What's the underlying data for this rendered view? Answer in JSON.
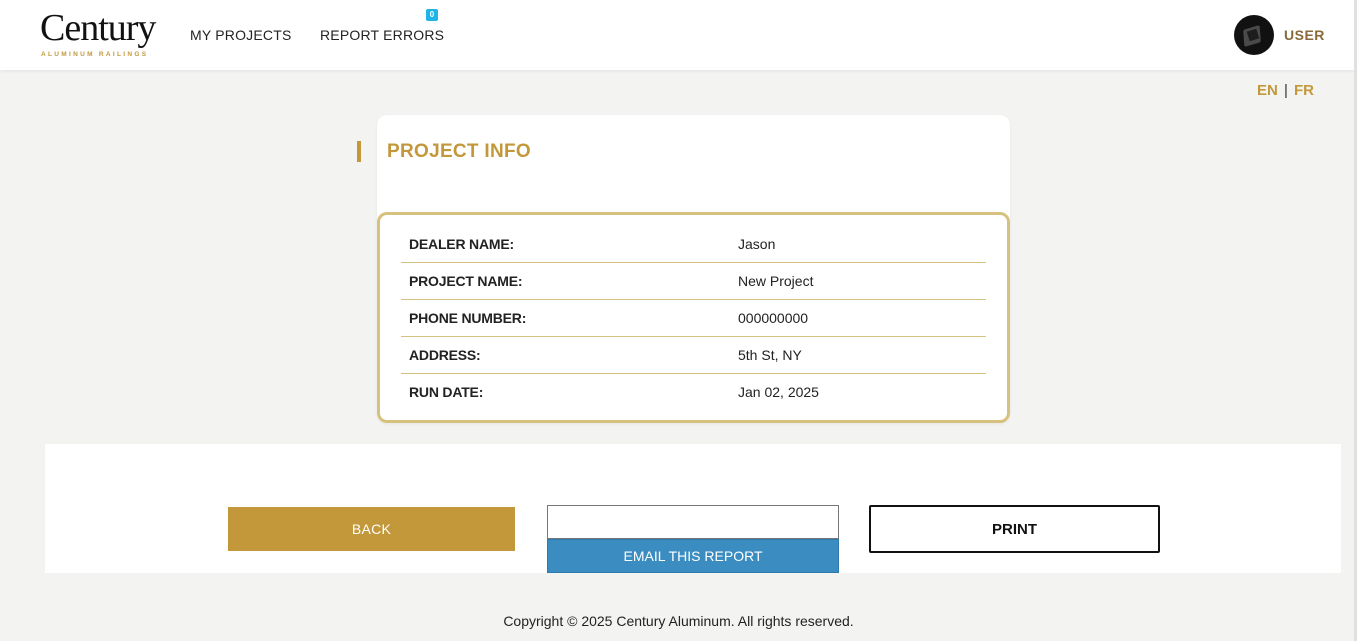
{
  "brand": {
    "logo_main": "Century",
    "logo_sub": "ALUMINUM RAILINGS",
    "accent_color": "#c2983a"
  },
  "nav": {
    "my_projects": "MY PROJECTS",
    "report_errors": "REPORT ERRORS",
    "report_errors_badge": "0",
    "user_label": "USER"
  },
  "language": {
    "en": "EN",
    "separator": "|",
    "fr": "FR"
  },
  "project_info": {
    "title": "PROJECT INFO",
    "rows": [
      {
        "label": "DEALER NAME:",
        "value": "Jason"
      },
      {
        "label": "PROJECT NAME:",
        "value": "New Project"
      },
      {
        "label": "PHONE NUMBER:",
        "value": "000000000"
      },
      {
        "label": "ADDRESS:",
        "value": "5th St, NY"
      },
      {
        "label": "RUN DATE:",
        "value": "Jan 02, 2025"
      }
    ]
  },
  "actions": {
    "back_label": "BACK",
    "email_input_value": "",
    "email_button_label": "EMAIL THIS REPORT",
    "print_label": "PRINT",
    "email_button_color": "#3b8cc0"
  },
  "footer": {
    "copyright": "Copyright © 2025 Century Aluminum. All rights reserved."
  }
}
